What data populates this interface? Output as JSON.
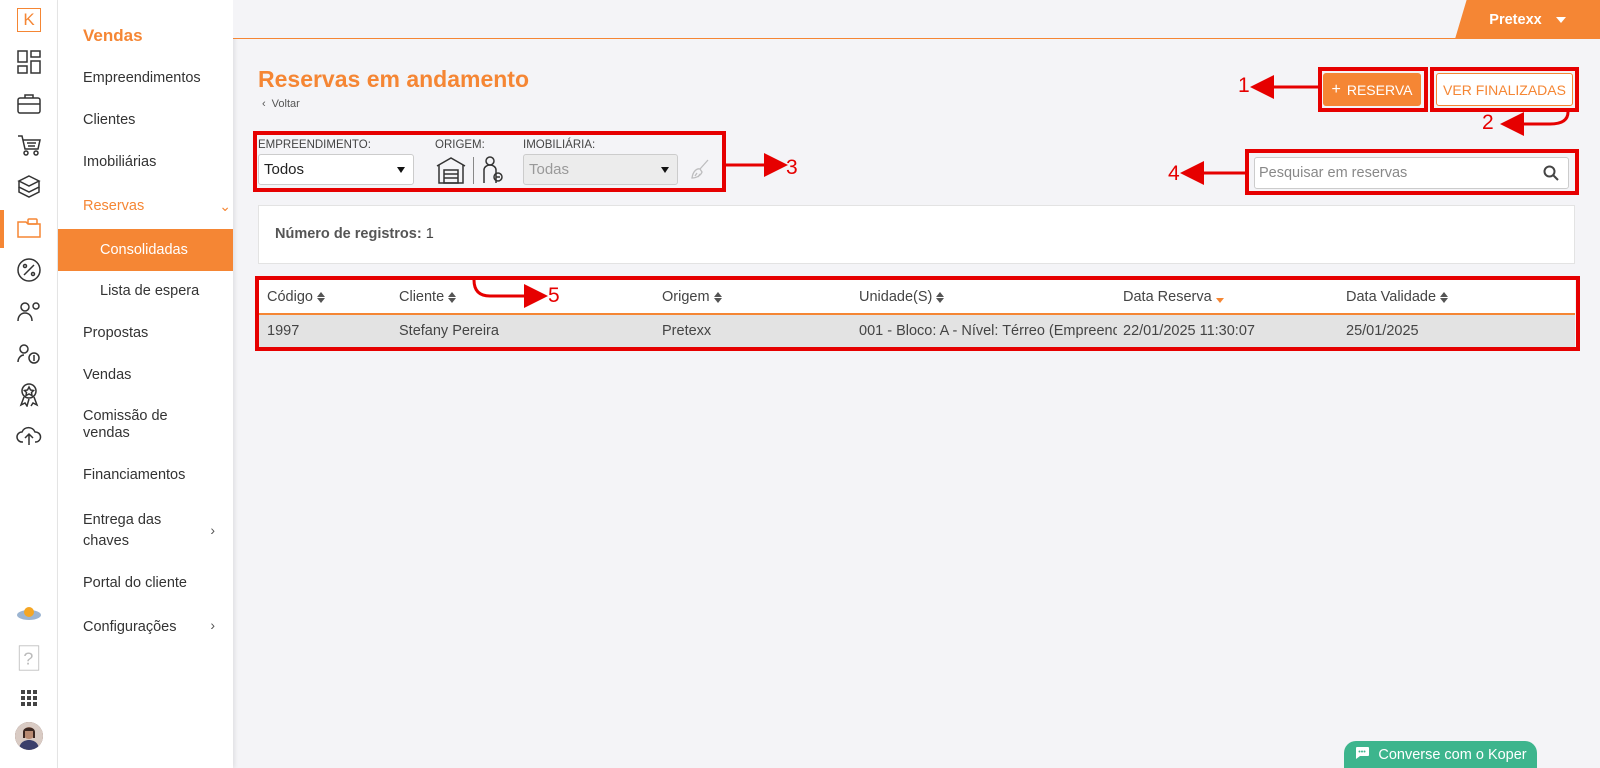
{
  "colors": {
    "accent": "#f58634",
    "annotation": "#e60000",
    "chat": "#3db58d"
  },
  "rail": {
    "logo": "K",
    "icons": [
      "dashboard-icon",
      "briefcase-icon",
      "cart-icon",
      "boxes-icon",
      "folder-money-icon",
      "percent-icon",
      "people-settings-icon",
      "people-money-icon",
      "award-icon",
      "cloud-upload-icon",
      "help-icon",
      "apps-grid-icon"
    ]
  },
  "sidebar": {
    "title": "Vendas",
    "items": [
      {
        "label": "Empreendimentos"
      },
      {
        "label": "Clientes"
      },
      {
        "label": "Imobiliárias"
      },
      {
        "label": "Reservas"
      },
      {
        "label": "Consolidadas"
      },
      {
        "label": "Lista de espera"
      },
      {
        "label": "Propostas"
      },
      {
        "label": "Vendas"
      },
      {
        "label": "Comissão de vendas"
      },
      {
        "label": "Financiamentos"
      },
      {
        "label": "Entrega das chaves"
      },
      {
        "label": "Portal do cliente"
      },
      {
        "label": "Configurações"
      }
    ]
  },
  "topbar": {
    "user": "Pretexx"
  },
  "header": {
    "title": "Reservas em andamento",
    "back": "Voltar",
    "new_button": "RESERVA",
    "finished_button": "VER FINALIZADAS"
  },
  "filters": {
    "empreendimento_label": "EMPREENDIMENTO:",
    "empreendimento_value": "Todos",
    "origem_label": "ORIGEM:",
    "imobiliaria_label": "IMOBILIÁRIA:",
    "imobiliaria_value": "Todas"
  },
  "search": {
    "placeholder": "Pesquisar em reservas"
  },
  "records": {
    "label": "Número de registros:",
    "count": "1"
  },
  "table": {
    "columns": [
      "Código",
      "Cliente",
      "Origem",
      "Unidade(S)",
      "Data Reserva",
      "Data Validade"
    ],
    "rows": [
      [
        "1997",
        "Stefany Pereira",
        "Pretexx",
        "001 - Bloco: A - Nível: Térreo (Empreend",
        "22/01/2025 11:30:07",
        "25/01/2025"
      ]
    ]
  },
  "annotations": [
    "1",
    "2",
    "3",
    "4",
    "5"
  ],
  "chat": {
    "label": "Converse com o Koper"
  }
}
